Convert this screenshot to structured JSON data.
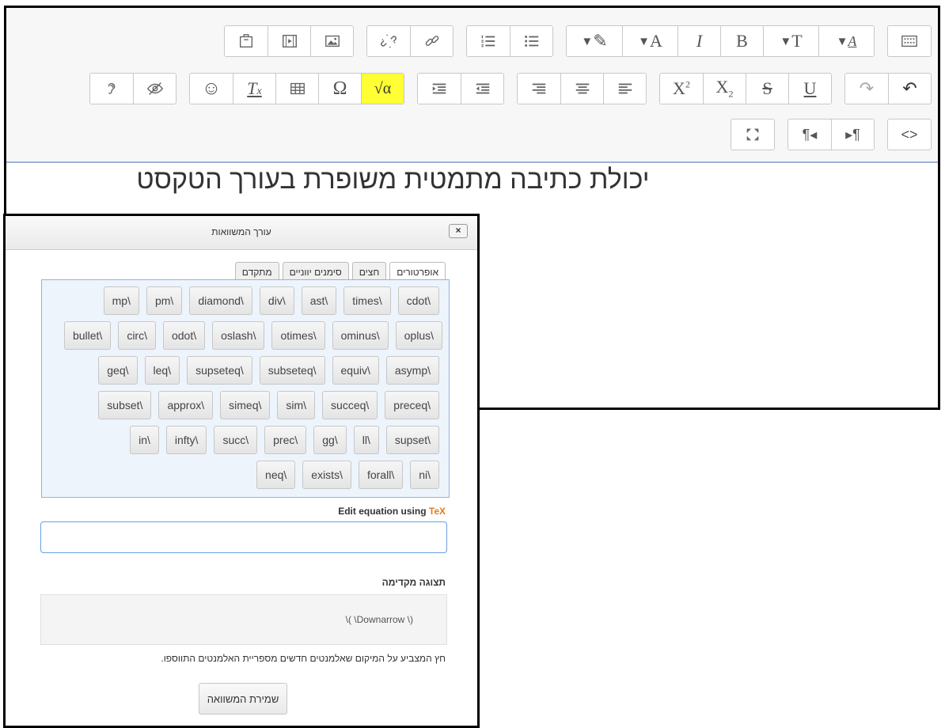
{
  "editor": {
    "content_line": "יכולת כתיבה מתמטית משופרת בעורך הטקסט"
  },
  "dialog": {
    "title": "עורך המשוואות",
    "close_label": "×",
    "tabs": [
      "אופרטורים",
      "חצים",
      "סימנים יווניים",
      "מתקדם"
    ],
    "palette_rows": [
      [
        "cdot\\",
        "times\\",
        "ast\\",
        "div\\",
        "diamond\\",
        "pm\\",
        "mp\\"
      ],
      [
        "oplus\\",
        "ominus\\",
        "otimes\\",
        "oslash\\",
        "odot\\",
        "circ\\",
        "bullet\\"
      ],
      [
        "asymp\\",
        "equiv\\",
        "subseteq\\",
        "supseteq\\",
        "leq\\",
        "geq\\"
      ],
      [
        "preceq\\",
        "succeq\\",
        "sim\\",
        "simeq\\",
        "approx\\",
        "subset\\"
      ],
      [
        "supset\\",
        "ll\\",
        "gg\\",
        "prec\\",
        "succ\\",
        "infty\\",
        "in\\"
      ],
      [
        "ni\\",
        "forall\\",
        "exists\\",
        "neq\\"
      ]
    ],
    "edit_label_prefix": "Edit equation using ",
    "edit_label_tex": "TeX",
    "tex_value": "",
    "preview_label": "תצוגה מקדימה",
    "preview_text": "\\( \\Downarrow \\)",
    "hint": "חץ המצביע על המיקום שאלמנטים חדשים מספריית האלמנטים התווספו.",
    "save_label": "שמירת המשוואה"
  },
  "colors": {
    "highlight": "#ffff33",
    "tex": "#e27b1c",
    "palette_bg": "#eef4fb",
    "palette_border": "#8fb3dd"
  }
}
